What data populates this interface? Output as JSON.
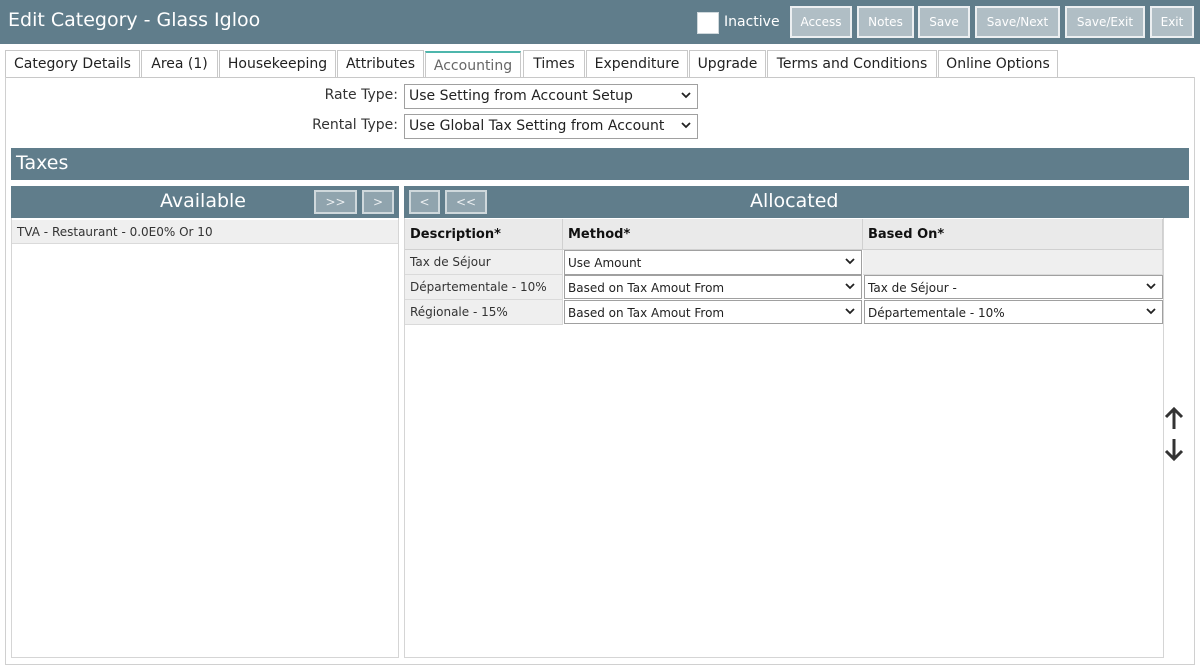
{
  "header": {
    "title": "Edit Category - Glass Igloo",
    "inactive_label": "Inactive",
    "buttons": [
      "Access",
      "Notes",
      "Save",
      "Save/Next",
      "Save/Exit",
      "Exit"
    ]
  },
  "tabs": [
    "Category Details",
    "Area (1)",
    "Housekeeping",
    "Attributes",
    "Accounting",
    "Times",
    "Expenditure",
    "Upgrade",
    "Terms and Conditions",
    "Online Options"
  ],
  "active_tab": "Accounting",
  "form": {
    "rate_type_label": "Rate Type:",
    "rate_type_value": "Use Setting from Account Setup",
    "rental_type_label": "Rental Type:",
    "rental_type_value": "Use Global Tax Setting from Account"
  },
  "taxes": {
    "title": "Taxes",
    "available": {
      "title": "Available",
      "move_all_label": ">>",
      "move_one_label": ">",
      "items": [
        "TVA - Restaurant - 0.0E0% Or 10"
      ]
    },
    "allocated": {
      "title": "Allocated",
      "remove_one_label": "<",
      "remove_all_label": "<<",
      "columns": [
        "Description*",
        "Method*",
        "Based On*"
      ],
      "rows": [
        {
          "description": "Tax de Séjour",
          "method": "Use Amount",
          "based_on": ""
        },
        {
          "description": "Départementale - 10%",
          "method": "Based on Tax Amout From",
          "based_on": "Tax de Séjour -"
        },
        {
          "description": "Régionale - 15%",
          "method": "Based on Tax Amout From",
          "based_on": "Départementale - 10%"
        }
      ]
    }
  },
  "colors": {
    "header_bg": "#607d8b",
    "button_bg": "#b0bec5",
    "active_tab_accent": "#4db6ac"
  },
  "icons": {
    "move_up": "arrow-up-icon",
    "move_down": "arrow-down-icon",
    "dropdown": "chevron-down-icon"
  }
}
